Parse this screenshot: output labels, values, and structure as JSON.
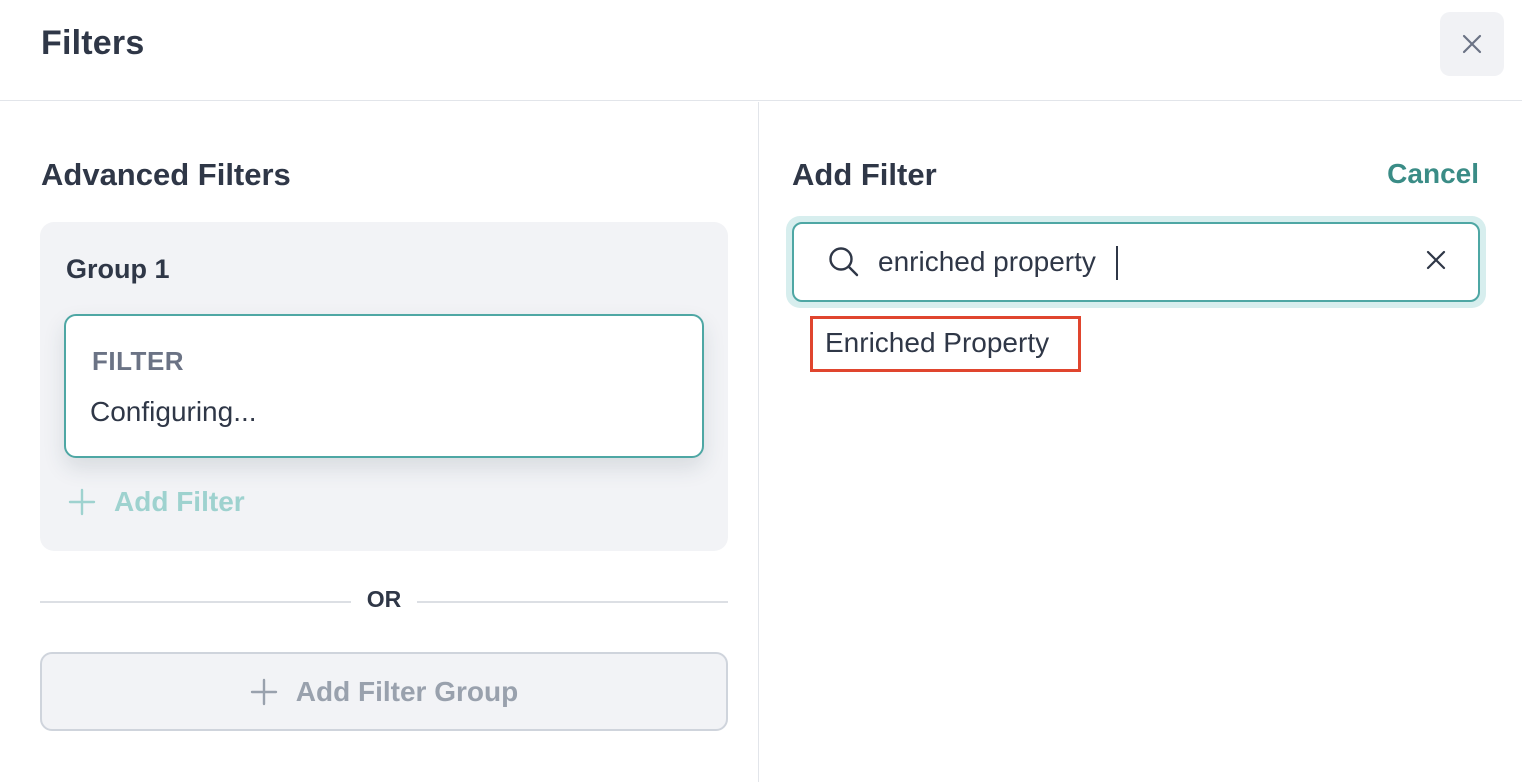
{
  "header": {
    "title": "Filters",
    "close_icon": "close-icon"
  },
  "left": {
    "title": "Advanced Filters",
    "group": {
      "title": "Group 1",
      "filter_card": {
        "label": "FILTER",
        "value": "Configuring..."
      },
      "add_filter_label": "Add Filter"
    },
    "or_label": "OR",
    "add_group_label": "Add Filter Group"
  },
  "right": {
    "title": "Add Filter",
    "cancel_label": "Cancel",
    "search": {
      "value": "enriched property",
      "icon": "search-icon"
    },
    "results": [
      {
        "label": "Enriched Property"
      }
    ]
  },
  "colors": {
    "accent": "#4ea7a4",
    "accent_text": "#3a8c86",
    "highlight": "#e0452e"
  }
}
